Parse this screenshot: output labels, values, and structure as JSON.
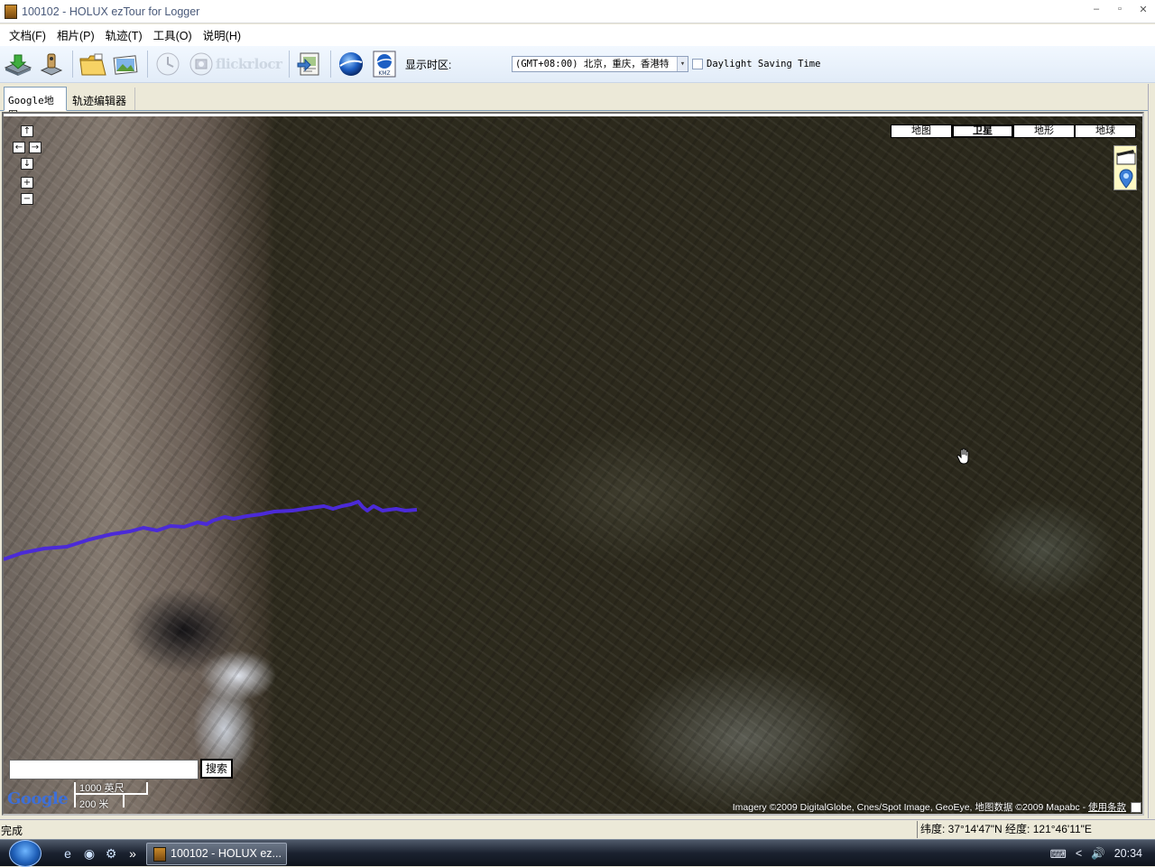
{
  "window": {
    "title": "100102 - HOLUX ezTour for Logger",
    "min_glyph": "–",
    "max_glyph": "▫",
    "close_glyph": "✕"
  },
  "menu": [
    "文档(F)",
    "相片(P)",
    "轨迹(T)",
    "工具(O)",
    "说明(H)"
  ],
  "toolbar": {
    "icons": [
      "import-gps-icon",
      "device-icon",
      "open-folder-icon",
      "photos-icon",
      "clock-icon",
      "camera-icon",
      "flickr-icon",
      "locr-icon",
      "export-icon",
      "google-earth-icon",
      "kmz-icon"
    ],
    "flickr_label": "flickr",
    "locr_label": "locr",
    "kmz_label": "KMZ",
    "timezone_label": "显示时区:",
    "timezone_value": "(GMT+08:00) 北京，重庆，香港特",
    "timezone_arrow": "▾",
    "dst_label": "Daylight Saving Time",
    "dst_checked": false
  },
  "tabs": [
    {
      "label": "Google地图",
      "active": true
    },
    {
      "label": "轨迹编辑器",
      "active": false
    }
  ],
  "map": {
    "nav": {
      "up": "↑",
      "left": "←",
      "right": "→",
      "down": "↓",
      "zoom_in": "+",
      "zoom_out": "−"
    },
    "map_types": [
      {
        "label": "地图",
        "selected": false
      },
      {
        "label": "卫星",
        "selected": true
      },
      {
        "label": "地形",
        "selected": false
      },
      {
        "label": "地球",
        "selected": false
      }
    ],
    "search_value": "",
    "search_button": "搜索",
    "google_logo": "Google",
    "scale_top": "1000 英尺",
    "scale_bottom": "200 米",
    "attribution": "Imagery ©2009 DigitalGlobe, Cnes/Spot Image, GeoEye, 地图数据 ©2009 Mapabc - ",
    "terms_link": "使用条款",
    "track_color": "#4b2ad8"
  },
  "status": {
    "left": "完成",
    "coords": "纬度: 37°14'47\"N  经度: 121°46'11\"E"
  },
  "taskbar": {
    "task_label": "100102 - HOLUX ez...",
    "chevron": "»",
    "tray_left": "<",
    "clock": "20:34"
  }
}
